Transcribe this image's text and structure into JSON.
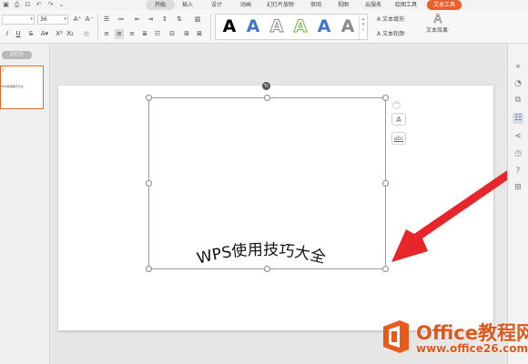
{
  "tabs": [
    "开始",
    "插入",
    "设计",
    "动画",
    "幻灯片放映",
    "审阅",
    "视图",
    "云服务",
    "绘图工具",
    "文本工具"
  ],
  "active_tab": "开始",
  "ribbon": {
    "font_size": "36",
    "font_name": "",
    "art_letter": "A",
    "text_fill_label": "文本填充·",
    "text_outline_label": "文本轮廓·",
    "text_effect_label": "文本效果·"
  },
  "left_pane": {
    "label": "幻灯片",
    "slide_number": "1",
    "thumb_text": "WPS使用技巧大全"
  },
  "slide": {
    "arc_text": "WPS使用技巧大全"
  },
  "float_buttons": {
    "collapse": "···",
    "style": "A",
    "abc": "abc"
  },
  "watermark": {
    "title": "Office教程网",
    "url": "www.office26.com"
  },
  "colors": {
    "accent": "#e8612c",
    "arrow": "#e8262a",
    "watermark": "#e0571b"
  },
  "icons": {
    "rail": [
      "pin-icon",
      "shapes-icon",
      "copy-icon",
      "settings-panel-icon",
      "share-icon",
      "history-icon",
      "help-icon",
      "apps-icon"
    ]
  }
}
